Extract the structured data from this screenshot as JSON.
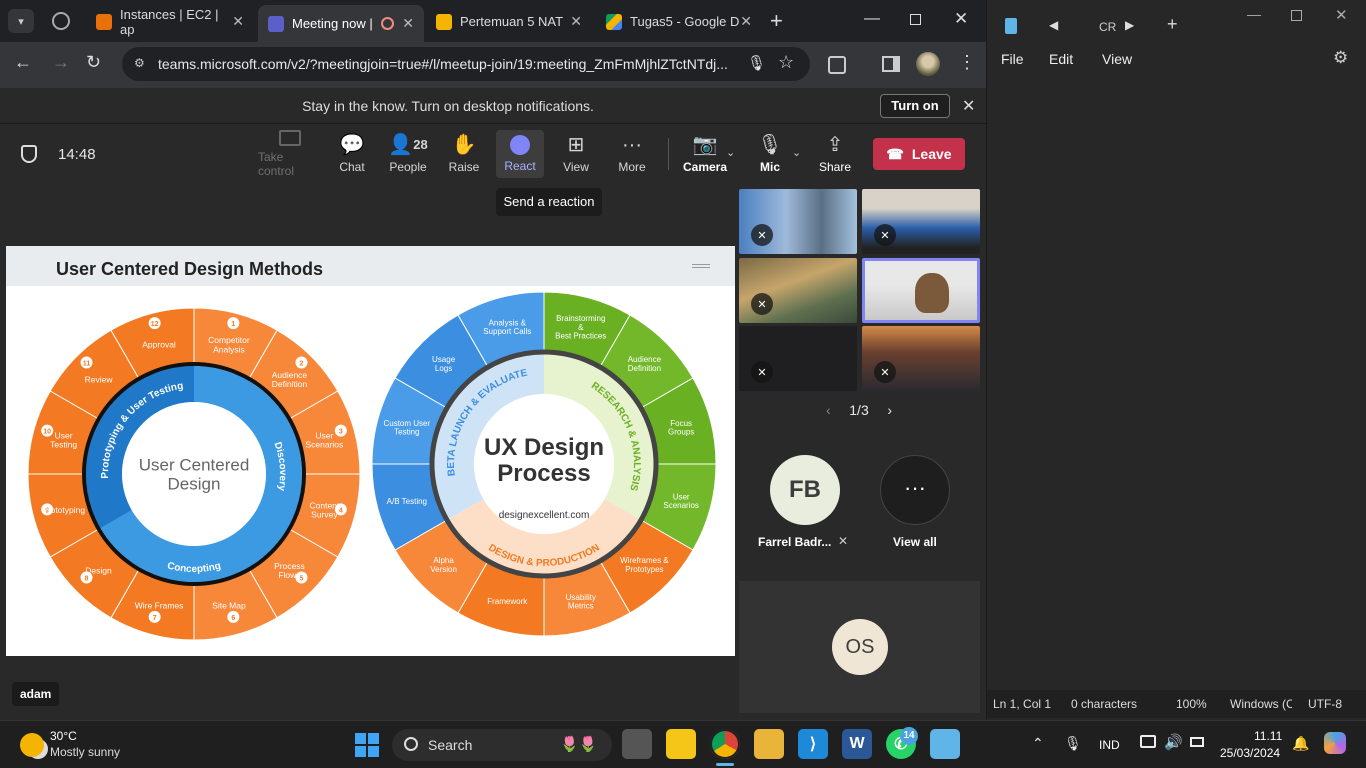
{
  "browser": {
    "tabs": [
      {
        "title": "Instances | EC2 | ap"
      },
      {
        "title": "Meeting now |"
      },
      {
        "title": "Pertemuan 5 NAT"
      },
      {
        "title": "Tugas5 - Google D"
      }
    ],
    "url": "teams.microsoft.com/v2/?meetingjoin=true#/l/meetup-join/19:meeting_ZmFmMjhlZTctNTdj..."
  },
  "notification": {
    "text": "Stay in the know. Turn on desktop notifications.",
    "button": "Turn on"
  },
  "meeting": {
    "timer": "14:48",
    "toolbar": {
      "take_control": "Take control",
      "chat": "Chat",
      "people": "People",
      "people_count": "28",
      "raise": "Raise",
      "react": "React",
      "view": "View",
      "more": "More",
      "camera": "Camera",
      "mic": "Mic",
      "share": "Share",
      "leave": "Leave"
    },
    "tooltip": "Send a reaction",
    "presenter_name": "adam",
    "pager": "1/3",
    "participants": [
      {
        "initials": "FB",
        "name": "Farrel Badr..."
      },
      {
        "initials": "OS"
      }
    ],
    "view_all": "View all"
  },
  "slide": {
    "title": "User Centered Design Methods",
    "ucd": {
      "center": [
        "User Centered",
        "Design"
      ],
      "arcs": [
        "Prototyping & User Testing",
        "Discovery",
        "Concepting"
      ],
      "steps": [
        {
          "n": "1",
          "label": [
            "Competitor",
            "Analysis"
          ]
        },
        {
          "n": "2",
          "label": [
            "Audience",
            "Definition"
          ]
        },
        {
          "n": "3",
          "label": [
            "User",
            "Scenarios"
          ]
        },
        {
          "n": "4",
          "label": [
            "Content",
            "Survey"
          ]
        },
        {
          "n": "5",
          "label": [
            "Process",
            "Flows"
          ]
        },
        {
          "n": "6",
          "label": [
            "Site Map"
          ]
        },
        {
          "n": "7",
          "label": [
            "Wire Frames"
          ]
        },
        {
          "n": "8",
          "label": [
            "Design"
          ]
        },
        {
          "n": "9",
          "label": [
            "Prototyping"
          ]
        },
        {
          "n": "10",
          "label": [
            "User",
            "Testing"
          ]
        },
        {
          "n": "11",
          "label": [
            "Review"
          ]
        },
        {
          "n": "12",
          "label": [
            "Approval"
          ]
        }
      ]
    },
    "ux": {
      "center": [
        "UX Design",
        "Process"
      ],
      "site": "designexcellent.com",
      "arcs": [
        "BETA LAUNCH & EVALUATE",
        "RESEARCH & ANALYSIS",
        "DESIGN & PRODUCTION"
      ],
      "items": [
        [
          "Brainstorming",
          "&",
          "Best Practices"
        ],
        [
          "Audience",
          "Definition"
        ],
        [
          "Focus",
          "Groups"
        ],
        [
          "User",
          "Scenarios"
        ],
        [
          "Wireframes &",
          "Prototypes"
        ],
        [
          "Usability",
          "Metrics"
        ],
        [
          "Framework"
        ],
        [
          "Alpha",
          "Version"
        ],
        [
          "A/B Testing"
        ],
        [
          "Custom User",
          "Testing"
        ],
        [
          "Usage",
          "Logs"
        ],
        [
          "Analysis &",
          "Support Calls"
        ]
      ]
    }
  },
  "notepad": {
    "tab": "CR",
    "menu": [
      "File",
      "Edit",
      "View"
    ],
    "status": [
      "Ln 1, Col 1",
      "0 characters",
      "100%",
      "Windows (C",
      "UTF-8"
    ]
  },
  "taskbar": {
    "weather_temp": "30°C",
    "weather_desc": "Mostly sunny",
    "search": "Search",
    "whatsapp_badge": "14",
    "lang": "IND",
    "time": "11.11",
    "date": "25/03/2024"
  }
}
